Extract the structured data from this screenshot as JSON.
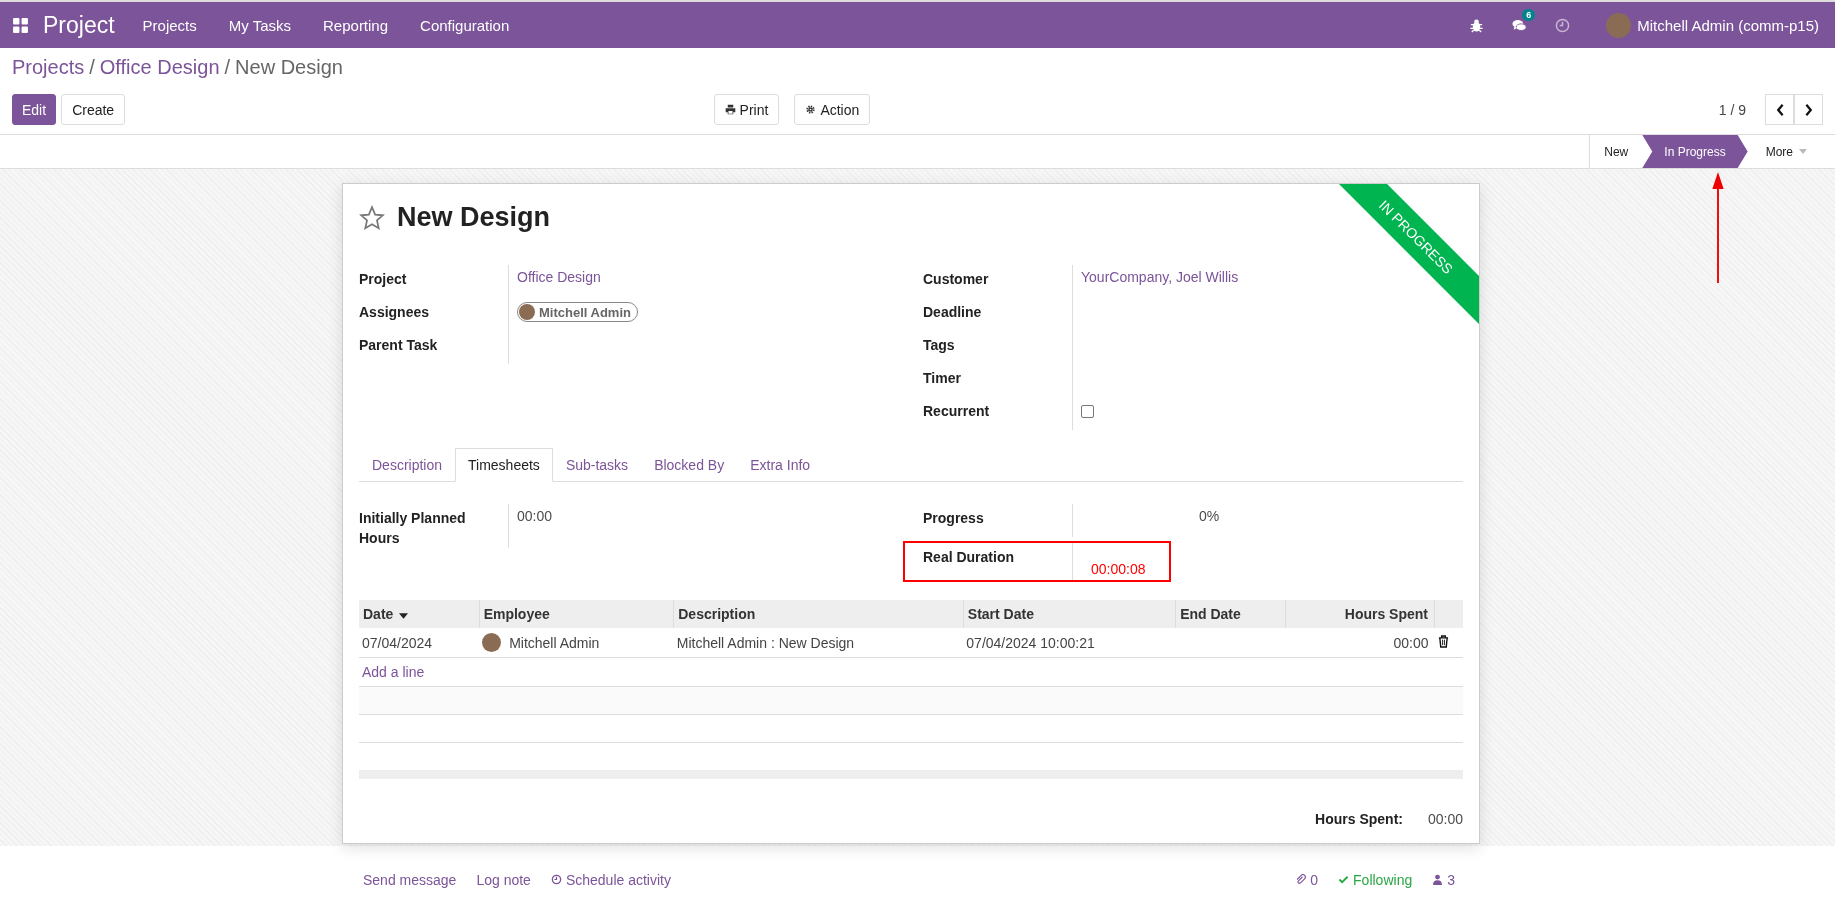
{
  "navbar": {
    "app_name": "Project",
    "menu": [
      "Projects",
      "My Tasks",
      "Reporting",
      "Configuration"
    ],
    "message_count": "6",
    "user": "Mitchell Admin (comm-p15)"
  },
  "breadcrumb_separator": "/",
  "breadcrumbs": [
    {
      "label": "Projects",
      "kind": "link"
    },
    {
      "label": "Office Design",
      "kind": "link"
    },
    {
      "label": "New Design",
      "kind": "current"
    }
  ],
  "buttons": {
    "edit": "Edit",
    "create": "Create",
    "print": "Print",
    "action": "Action"
  },
  "pager": "1 / 9",
  "stages": [
    {
      "label": "New",
      "selected": false
    },
    {
      "label": "In Progress",
      "selected": true
    }
  ],
  "stage_more": "More",
  "record": {
    "title": "New Design",
    "starred": false,
    "ribbon": "IN PROGRESS",
    "left_fields": [
      {
        "label": "Project",
        "kind": "link",
        "value": "Office Design"
      },
      {
        "label": "Assignees",
        "kind": "tag",
        "value": "Mitchell Admin"
      },
      {
        "label": "Parent Task",
        "kind": "text"
      }
    ],
    "right_fields": [
      {
        "label": "Customer",
        "kind": "link",
        "value": "YourCompany, Joel Willis"
      },
      {
        "label": "Deadline",
        "kind": "text"
      },
      {
        "label": "Tags",
        "kind": "text"
      },
      {
        "label": "Timer",
        "kind": "text"
      },
      {
        "label": "Recurrent",
        "kind": "checkbox",
        "checked": false
      }
    ]
  },
  "tabs": [
    {
      "label": "Description",
      "selected": false
    },
    {
      "label": "Timesheets",
      "selected": true
    },
    {
      "label": "Sub-tasks",
      "selected": false
    },
    {
      "label": "Blocked By",
      "selected": false
    },
    {
      "label": "Extra Info",
      "selected": false
    }
  ],
  "timesheets": {
    "planned_label": "Initially Planned Hours",
    "planned_value": "00:00",
    "progress_label": "Progress",
    "progress_value": "0%",
    "duration_label": "Real Duration",
    "duration_value": "00:00:08",
    "duration_highlighted": true,
    "table": {
      "columns": [
        "Date",
        "Employee",
        "Description",
        "Start Date",
        "End Date",
        "Hours Spent"
      ],
      "rows": [
        {
          "date": "07/04/2024",
          "employee": "Mitchell Admin",
          "description": "Mitchell Admin : New Design",
          "start": "07/04/2024 10:00:21",
          "hours": "00:00"
        }
      ],
      "add_line": "Add a line"
    },
    "total_label": "Hours Spent:",
    "total_value": "00:00"
  },
  "chatter": {
    "send": "Send message",
    "log": "Log note",
    "schedule": "Schedule activity",
    "attachments": "0",
    "following": "Following",
    "followers": "3"
  }
}
